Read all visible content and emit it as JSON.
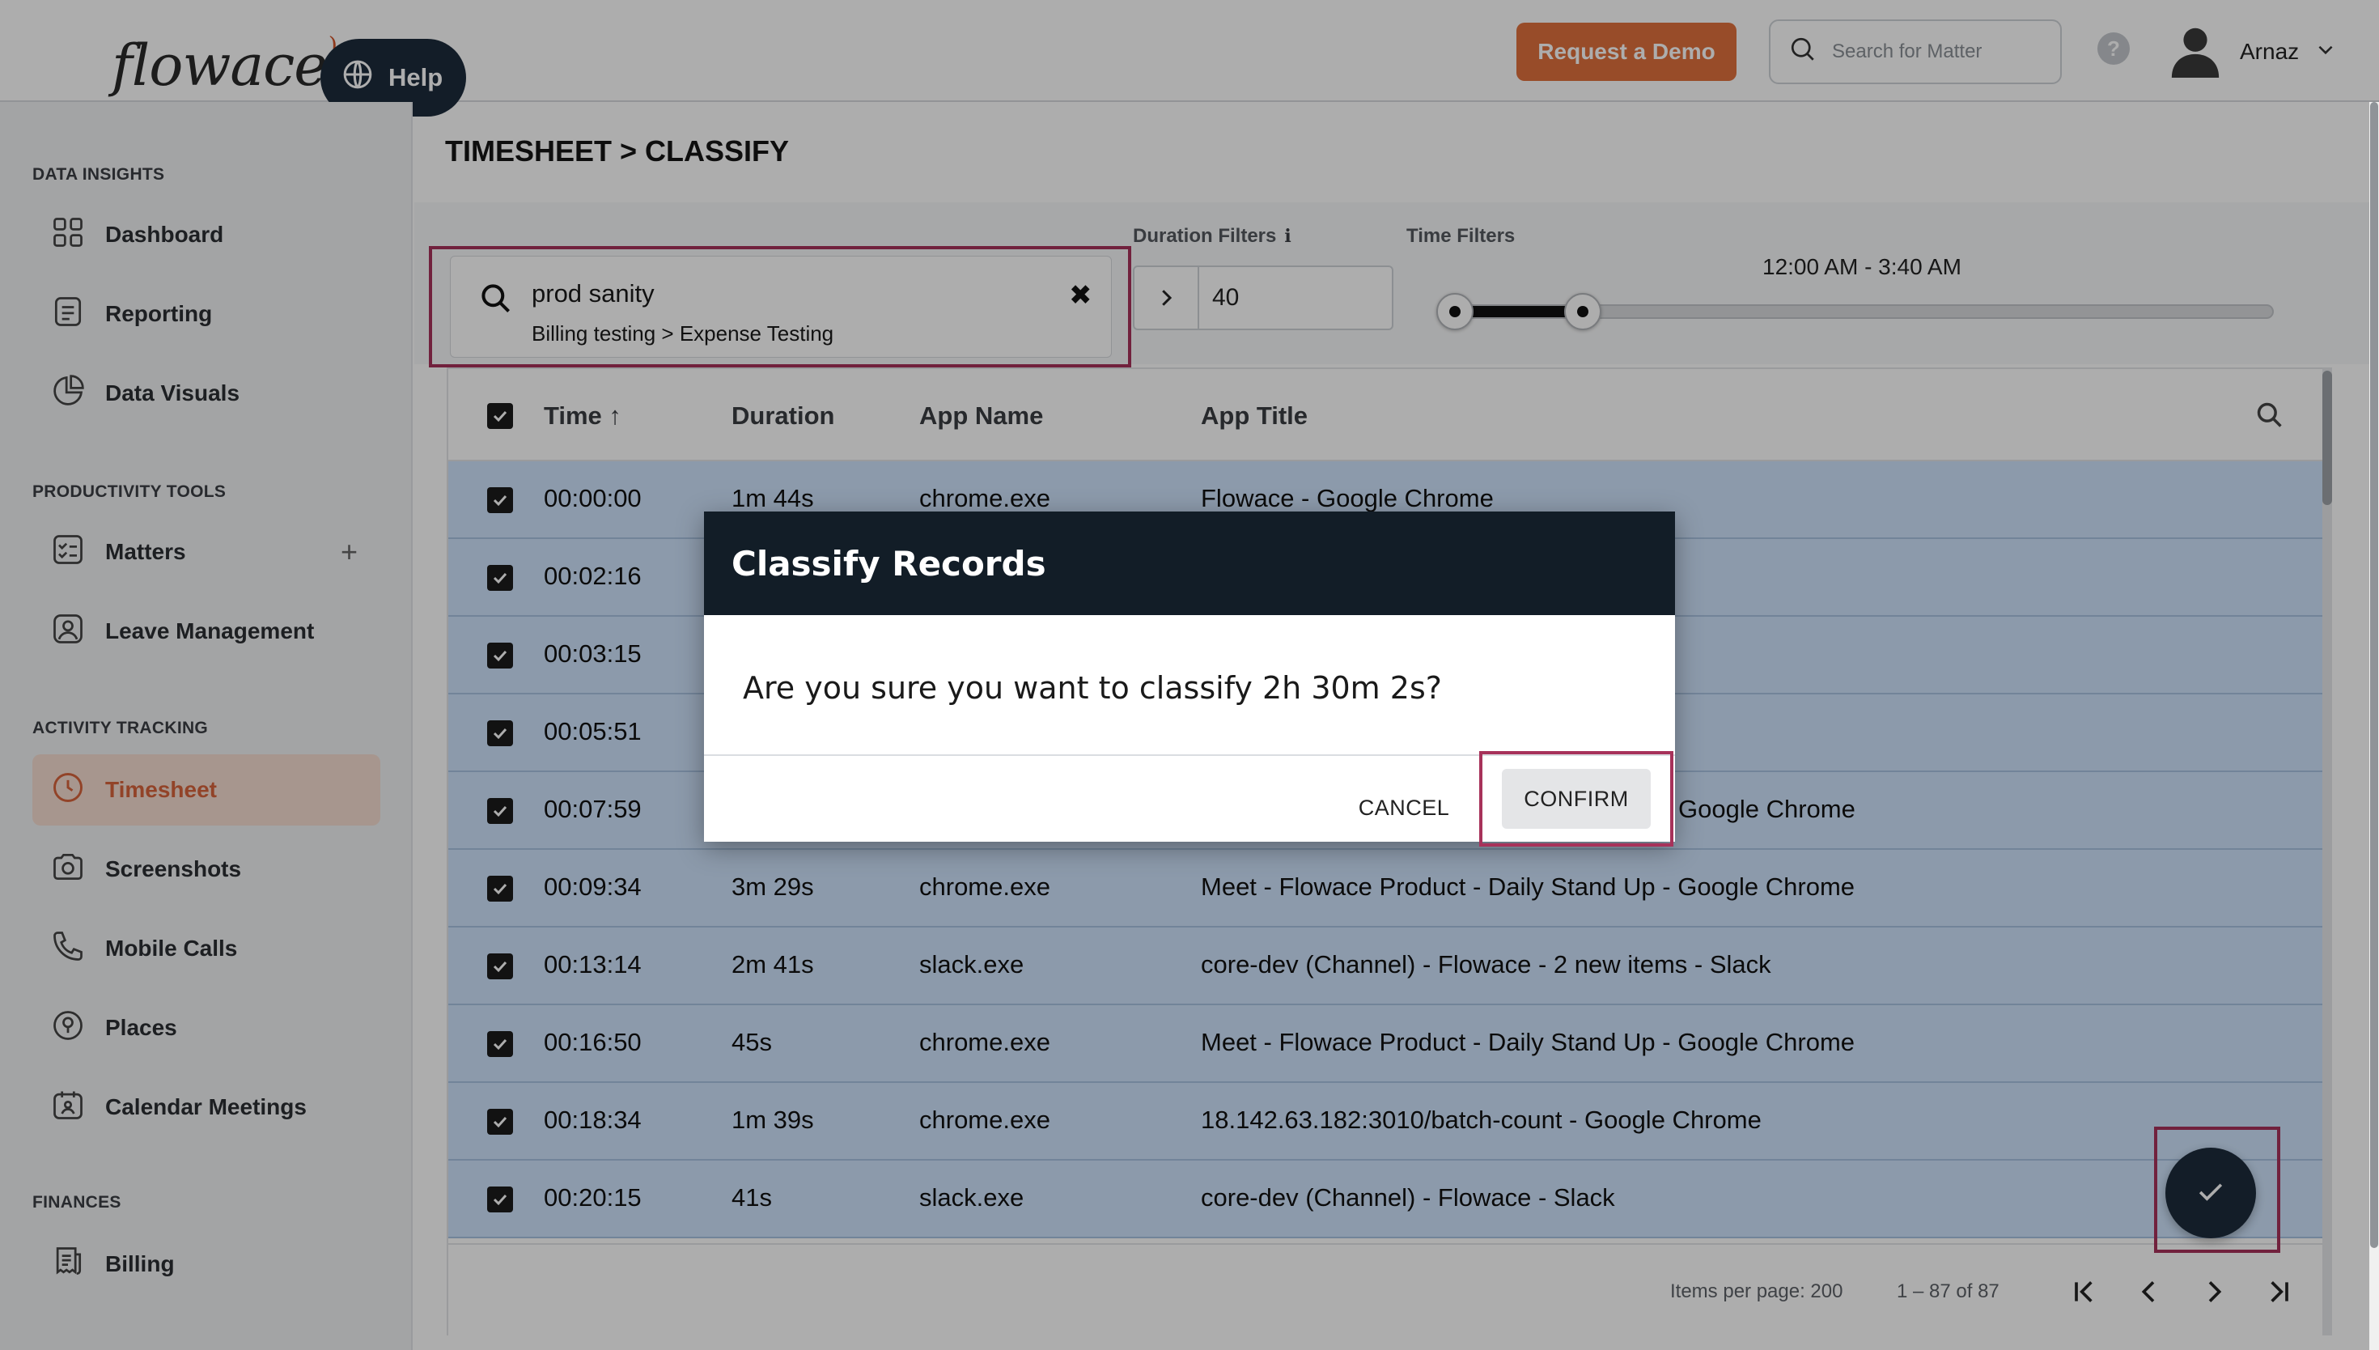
{
  "app": {
    "logo_text": "flowace",
    "help_label": "Help",
    "demo_label": "Request a Demo",
    "matter_search_placeholder": "Search for Matter",
    "help_glyph": "?",
    "user_name": "Arnaz",
    "accent_color": "#e0703d"
  },
  "sidebar": {
    "sections": [
      {
        "title": "DATA INSIGHTS",
        "items": [
          {
            "label": "Dashboard",
            "icon": "grid-icon"
          },
          {
            "label": "Reporting",
            "icon": "report-icon"
          },
          {
            "label": "Data Visuals",
            "icon": "pie-chart-icon"
          }
        ]
      },
      {
        "title": "PRODUCTIVITY TOOLS",
        "items": [
          {
            "label": "Matters",
            "icon": "checklist-icon",
            "extra": "+"
          },
          {
            "label": "Leave Management",
            "icon": "image-icon"
          }
        ]
      },
      {
        "title": "ACTIVITY TRACKING",
        "items": [
          {
            "label": "Timesheet",
            "icon": "clock-icon",
            "active": true
          },
          {
            "label": "Screenshots",
            "icon": "camera-icon"
          },
          {
            "label": "Mobile Calls",
            "icon": "phone-icon"
          },
          {
            "label": "Places",
            "icon": "location-icon"
          },
          {
            "label": "Calendar Meetings",
            "icon": "calendar-icon"
          }
        ]
      },
      {
        "title": "FINANCES",
        "items": [
          {
            "label": "Billing",
            "icon": "invoice-icon"
          }
        ]
      }
    ]
  },
  "page": {
    "title": "TIMESHEET > CLASSIFY"
  },
  "selected_matter": {
    "name": "prod sanity",
    "path": "Billing testing > Expense Testing"
  },
  "filters": {
    "duration_label": "Duration Filters",
    "duration_value": "40",
    "time_label": "Time Filters",
    "time_range": "12:00 AM - 3:40 AM"
  },
  "table": {
    "columns": [
      "Time",
      "Duration",
      "App Name",
      "App Title"
    ],
    "rows": [
      {
        "time": "00:00:00",
        "duration": "1m 44s",
        "app": "chrome.exe",
        "title": "Flowace - Google Chrome"
      },
      {
        "time": "00:02:16",
        "duration": "",
        "app": "",
        "title": ""
      },
      {
        "time": "00:03:15",
        "duration": "",
        "app": "",
        "title": ""
      },
      {
        "time": "00:05:51",
        "duration": "",
        "app": "",
        "title": ""
      },
      {
        "time": "00:07:59",
        "duration": "",
        "app": "",
        "title": "Google Chrome"
      },
      {
        "time": "00:09:34",
        "duration": "3m 29s",
        "app": "chrome.exe",
        "title": "Meet - Flowace Product - Daily Stand Up - Google Chrome"
      },
      {
        "time": "00:13:14",
        "duration": "2m 41s",
        "app": "slack.exe",
        "title": "core-dev (Channel) - Flowace - 2 new items - Slack"
      },
      {
        "time": "00:16:50",
        "duration": "45s",
        "app": "chrome.exe",
        "title": "Meet - Flowace Product - Daily Stand Up - Google Chrome"
      },
      {
        "time": "00:18:34",
        "duration": "1m 39s",
        "app": "chrome.exe",
        "title": "18.142.63.182:3010/batch-count - Google Chrome"
      },
      {
        "time": "00:20:15",
        "duration": "41s",
        "app": "slack.exe",
        "title": "core-dev (Channel) - Flowace - Slack"
      }
    ],
    "footer": {
      "items_per_page": "Items per page: 200",
      "range": "1 – 87 of 87"
    }
  },
  "dialog": {
    "title": "Classify Records",
    "message": "Are you sure you want to classify 2h 30m 2s?",
    "cancel_label": "CANCEL",
    "confirm_label": "CONFIRM"
  }
}
